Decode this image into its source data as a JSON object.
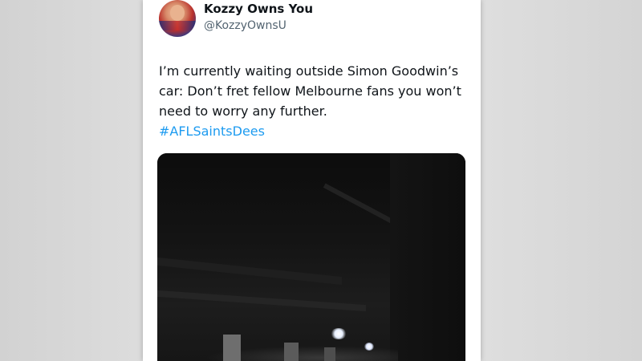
{
  "tweet": {
    "author": {
      "display_name": "Kozzy Owns You",
      "handle": "@KozzyOwnsU"
    },
    "text_lines": [
      "I’m currently waiting outside Simon Goodwin’s",
      "car: Don’t fret fellow Melbourne fans you won’t",
      "need to worry any further."
    ],
    "hashtag": "#AFLSaintsDees",
    "colors": {
      "hashtag": "#1d9bf0",
      "text": "#0f1419",
      "handle": "#536471"
    }
  }
}
